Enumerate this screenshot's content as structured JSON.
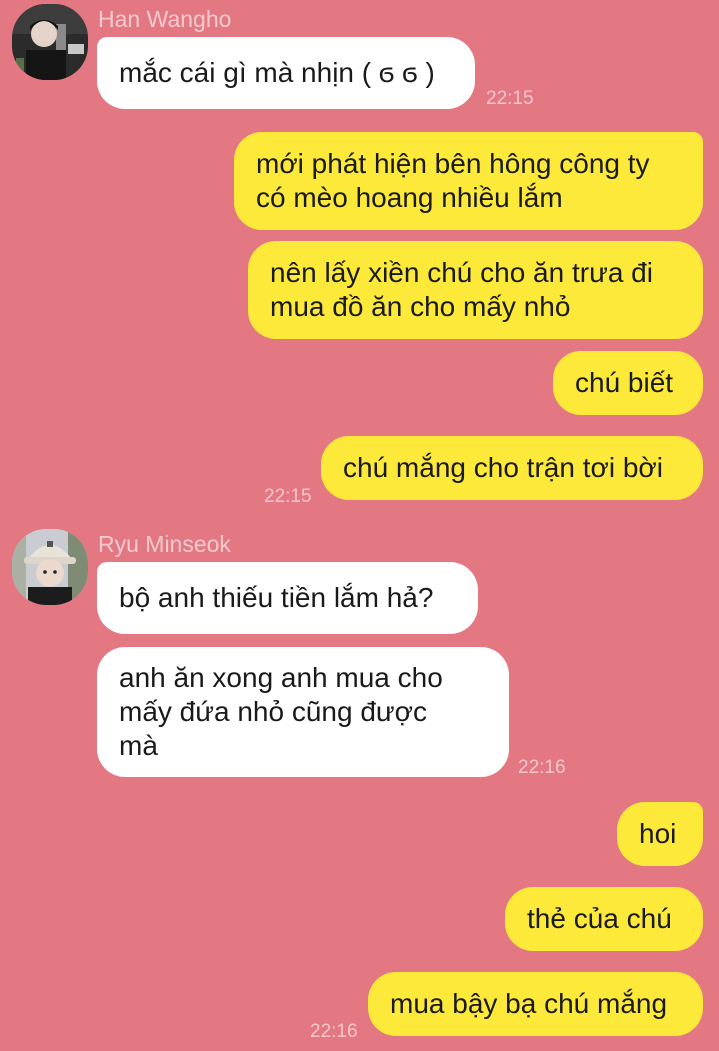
{
  "chat": {
    "han_name": "Han Wangho",
    "han_msg1": "mắc cái gì mà nhịn ( ϭ ϭ )",
    "han_time": "22:15",
    "me_msg1_l1": "mới phát hiện bên hông công ty",
    "me_msg1_l2": "có mèo hoang nhiều lắm",
    "me_msg2_l1": "nên lấy xiền chú cho ăn trưa đi",
    "me_msg2_l2": "mua đồ ăn cho mấy nhỏ",
    "me_msg3": "chú biết",
    "me_msg4": "chú mắng cho trận tơi bời",
    "me_time1": "22:15",
    "ryu_name": "Ryu Minseok",
    "ryu_msg1": "bộ anh thiếu tiền lắm hả?",
    "ryu_msg2_l1": "anh ăn xong anh mua cho",
    "ryu_msg2_l2": "mấy đứa nhỏ cũng được",
    "ryu_msg2_l3": "mà",
    "ryu_time": "22:16",
    "me_msg5": "hoi",
    "me_msg6": "thẻ của chú",
    "me_msg7": "mua bậy bạ chú mắng",
    "me_time2": "22:16"
  }
}
